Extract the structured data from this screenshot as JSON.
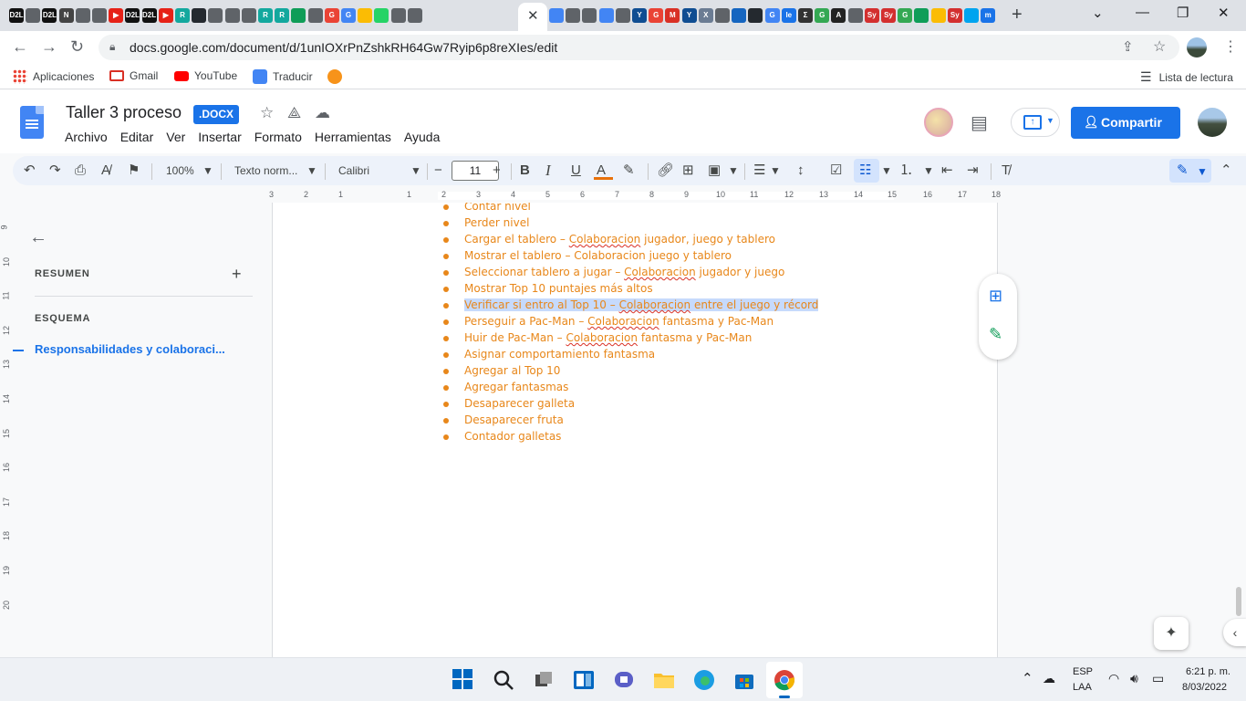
{
  "browser": {
    "tab_favicons": [
      {
        "name": "d21",
        "label": "D2L",
        "bg": "#111111"
      },
      {
        "name": "globe",
        "label": "",
        "bg": "#5f6368"
      },
      {
        "name": "d21",
        "label": "D2L",
        "bg": "#111111"
      },
      {
        "name": "notion",
        "label": "N",
        "bg": "#444444"
      },
      {
        "name": "globe",
        "label": "",
        "bg": "#5f6368"
      },
      {
        "name": "globe",
        "label": "",
        "bg": "#5f6368"
      },
      {
        "name": "youtube",
        "label": "▶",
        "bg": "#e62117"
      },
      {
        "name": "d21",
        "label": "D2L",
        "bg": "#111111"
      },
      {
        "name": "d21",
        "label": "D2L",
        "bg": "#111111"
      },
      {
        "name": "youtube",
        "label": "▶",
        "bg": "#e62117"
      },
      {
        "name": "research",
        "label": "R",
        "bg": "#13a89e"
      },
      {
        "name": "github",
        "label": "",
        "bg": "#24292f"
      },
      {
        "name": "globe",
        "label": "",
        "bg": "#5f6368"
      },
      {
        "name": "globe",
        "label": "",
        "bg": "#5f6368"
      },
      {
        "name": "globe",
        "label": "",
        "bg": "#5f6368"
      },
      {
        "name": "research",
        "label": "R",
        "bg": "#13a89e"
      },
      {
        "name": "research",
        "label": "R",
        "bg": "#13a89e"
      },
      {
        "name": "sheets",
        "label": "",
        "bg": "#0f9d58"
      },
      {
        "name": "globe",
        "label": "",
        "bg": "#5f6368"
      },
      {
        "name": "google",
        "label": "G",
        "bg": "#ea4335"
      },
      {
        "name": "google",
        "label": "G",
        "bg": "#4285f4"
      },
      {
        "name": "pencil",
        "label": "",
        "bg": "#fbbc04"
      },
      {
        "name": "whatsapp",
        "label": "",
        "bg": "#25d366"
      },
      {
        "name": "globe",
        "label": "",
        "bg": "#5f6368"
      },
      {
        "name": "globe",
        "label": "",
        "bg": "#5f6368"
      }
    ],
    "tab_favicons_right": [
      {
        "name": "docs",
        "label": "",
        "bg": "#4285f4"
      },
      {
        "name": "globe",
        "label": "",
        "bg": "#5f6368"
      },
      {
        "name": "globe",
        "label": "",
        "bg": "#5f6368"
      },
      {
        "name": "docs",
        "label": "",
        "bg": "#4285f4"
      },
      {
        "name": "globe",
        "label": "",
        "bg": "#5f6368"
      },
      {
        "name": "yale",
        "label": "Y",
        "bg": "#0f4d92"
      },
      {
        "name": "google",
        "label": "G",
        "bg": "#ea4335"
      },
      {
        "name": "gmail",
        "label": "M",
        "bg": "#d93025"
      },
      {
        "name": "yale",
        "label": "Y",
        "bg": "#0f4d92"
      },
      {
        "name": "x-tool",
        "label": "X",
        "bg": "#6b7c93"
      },
      {
        "name": "globe",
        "label": "",
        "bg": "#5f6368"
      },
      {
        "name": "cube",
        "label": "",
        "bg": "#1565c0"
      },
      {
        "name": "github",
        "label": "",
        "bg": "#24292f"
      },
      {
        "name": "google",
        "label": "G",
        "bg": "#4285f4"
      },
      {
        "name": "le",
        "label": "le",
        "bg": "#1a73e8"
      },
      {
        "name": "sigma",
        "label": "Σ",
        "bg": "#333333"
      },
      {
        "name": "google",
        "label": "G",
        "bg": "#34a853"
      },
      {
        "name": "a",
        "label": "A",
        "bg": "#222222"
      },
      {
        "name": "globe",
        "label": "",
        "bg": "#5f6368"
      },
      {
        "name": "symbolab",
        "label": "Sy",
        "bg": "#d32f2f"
      },
      {
        "name": "symbolab",
        "label": "Sy",
        "bg": "#d32f2f"
      },
      {
        "name": "google",
        "label": "G",
        "bg": "#34a853"
      },
      {
        "name": "shield",
        "label": "",
        "bg": "#0f9d58"
      },
      {
        "name": "drive",
        "label": "",
        "bg": "#fbbc04"
      },
      {
        "name": "symbolab",
        "label": "Sy",
        "bg": "#d32f2f"
      },
      {
        "name": "windows",
        "label": "",
        "bg": "#00a4ef"
      },
      {
        "name": "m",
        "label": "m",
        "bg": "#1a73e8"
      }
    ],
    "active_tab_close": "✕",
    "url": "docs.google.com/document/d/1unIOXrPnZshkRH64Gw7Ryip6p8reXIes/edit",
    "bookmarks": [
      {
        "label": "Aplicaciones",
        "icon": "apps-grid-icon",
        "color": "#ea4335"
      },
      {
        "label": "Gmail",
        "icon": "gmail-icon",
        "color": "#d93025"
      },
      {
        "label": "YouTube",
        "icon": "youtube-icon",
        "color": "#ff0000"
      },
      {
        "label": "Traducir",
        "icon": "translate-icon",
        "color": "#4285f4"
      },
      {
        "label": "",
        "icon": "bitcoin-icon",
        "color": "#f7931a"
      }
    ],
    "reading_list": "Lista de lectura"
  },
  "docs": {
    "title": "Taller 3 proceso",
    "badge": ".DOCX",
    "menus": [
      "Archivo",
      "Editar",
      "Ver",
      "Insertar",
      "Formato",
      "Herramientas",
      "Ayuda"
    ],
    "share_label": "Compartir",
    "toolbar": {
      "zoom": "100%",
      "style": "Texto norm...",
      "font": "Calibri",
      "font_size": "11"
    }
  },
  "outline": {
    "summary_label": "RESUMEN",
    "outline_label": "ESQUEMA",
    "heading": "Responsabilidades y colaboraci..."
  },
  "ruler": {
    "h_numbers": [
      "3",
      "2",
      "1",
      "1",
      "2",
      "3",
      "4",
      "5",
      "6",
      "7",
      "8",
      "9",
      "10",
      "11",
      "12",
      "13",
      "14",
      "15",
      "16",
      "17",
      "18"
    ],
    "v_numbers": [
      "9",
      "10",
      "11",
      "12",
      "13",
      "14",
      "15",
      "16",
      "17",
      "18",
      "19",
      "20"
    ]
  },
  "document": {
    "bullets": [
      {
        "pre": "Contar nivel",
        "squiggle": "",
        "post": "",
        "selected": false
      },
      {
        "pre": "Perder nivel",
        "squiggle": "",
        "post": "",
        "selected": false
      },
      {
        "pre": "Cargar el tablero – ",
        "squiggle": "Colaboracion",
        "post": " jugador, juego y tablero",
        "selected": false
      },
      {
        "pre": "Mostrar el tablero – Colaboracion juego y tablero",
        "squiggle": "",
        "post": "",
        "selected": false
      },
      {
        "pre": "Seleccionar tablero a jugar – ",
        "squiggle": "Colaboracion",
        "post": " jugador y juego",
        "selected": false
      },
      {
        "pre": "Mostrar Top 10 puntajes más altos",
        "squiggle": "",
        "post": "",
        "selected": false
      },
      {
        "pre": "Verificar si entro al Top 10 – ",
        "squiggle": "Colaboracion",
        "post": " entre el juego y récord",
        "selected": true
      },
      {
        "pre": "Perseguir a Pac-Man – ",
        "squiggle": "Colaboracion",
        "post": " fantasma y Pac-Man",
        "selected": false
      },
      {
        "pre": "Huir de Pac-Man – ",
        "squiggle": "Colaboracion",
        "post": " fantasma y Pac-Man",
        "selected": false
      },
      {
        "pre": "Asignar comportamiento fantasma",
        "squiggle": "",
        "post": "",
        "selected": false
      },
      {
        "pre": "Agregar al Top 10",
        "squiggle": "",
        "post": "",
        "selected": false
      },
      {
        "pre": "Agregar fantasmas",
        "squiggle": "",
        "post": "",
        "selected": false
      },
      {
        "pre": "Desaparecer galleta",
        "squiggle": "",
        "post": "",
        "selected": false
      },
      {
        "pre": "Desaparecer fruta",
        "squiggle": "",
        "post": "",
        "selected": false
      },
      {
        "pre": "Contador galletas",
        "squiggle": "",
        "post": "",
        "selected": false
      }
    ]
  },
  "taskbar": {
    "lang": "ESP",
    "layout": "LAA",
    "time": "6:21 p. m.",
    "date": "8/03/2022"
  }
}
